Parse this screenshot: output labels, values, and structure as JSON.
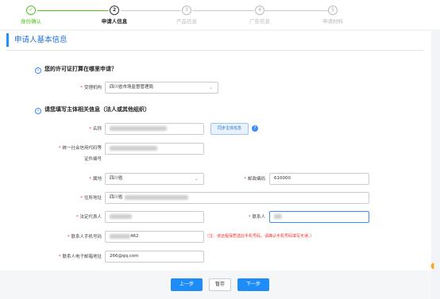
{
  "steps": [
    {
      "num": "✓",
      "label": "身份确认",
      "state": "done"
    },
    {
      "num": "2",
      "label": "申请人信息",
      "state": "active"
    },
    {
      "num": "3",
      "label": "产品信息",
      "state": "todo"
    },
    {
      "num": "4",
      "label": "广告信息",
      "state": "todo"
    },
    {
      "num": "5",
      "label": "申请材料",
      "state": "todo"
    }
  ],
  "page_title": "申请人基本信息",
  "section1": {
    "title": "您的许可证打算在哪里申请？",
    "label": "受理机构",
    "value": "四川省市场监督管理局"
  },
  "section2": {
    "title": "请您填写主体相关信息（法人或其他组织）"
  },
  "fields": {
    "name_label": "名称",
    "name_value": "",
    "sync_button": "同步主体信息",
    "help_icon": "?",
    "credit_label_1": "统一社会信用代码等",
    "credit_label_2": "证件编号",
    "region_label": "属地",
    "region_value": "四川省",
    "postal_label": "邮政编码",
    "postal_value": "610000",
    "address_label": "住所地址",
    "address_value": "四川省",
    "legal_rep_label": "法定代表人",
    "contact_label": "联系人",
    "contact_value": "",
    "phone_label": "联系人手机号码",
    "phone_value": "462",
    "phone_note": "（注：该远程保质送此手机号码，请确认手机号码填写无误。）",
    "email_label": "联系人电子邮箱地址",
    "email_value": "266@qq.com"
  },
  "footer": {
    "prev": "上一步",
    "save": "暂存",
    "next": "下一步"
  },
  "colors": {
    "accent": "#1d8cf8",
    "done": "#52c41a",
    "required": "#e33333"
  }
}
